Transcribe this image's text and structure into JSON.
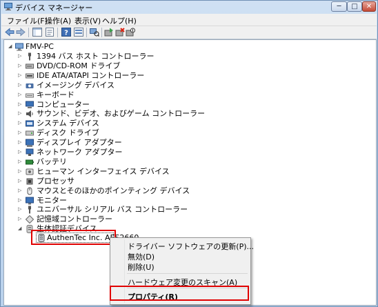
{
  "window": {
    "title": "デバイス マネージャー",
    "min_glyph": "─",
    "max_glyph": "□",
    "close_glyph": "✕"
  },
  "menu": [
    "ファイル(F)",
    "操作(A)",
    "表示(V)",
    "ヘルプ(H)"
  ],
  "toolbar": [
    "back-icon",
    "forward-icon",
    "show-hide-tree-icon",
    "properties-icon",
    "help-icon",
    "scan-hardware-icon",
    "update-driver-icon",
    "uninstall-icon",
    "disable-icon"
  ],
  "tree": {
    "root": "FMV-PC",
    "items": [
      {
        "label": "1394 バス ホスト コントローラー",
        "icon": "usb-plug-icon",
        "color": "#555555"
      },
      {
        "label": "DVD/CD-ROM ドライブ",
        "icon": "optical-drive-icon",
        "color": "#606060"
      },
      {
        "label": "IDE ATA/ATAPI コントローラー",
        "icon": "ide-controller-icon",
        "color": "#6c6c6c"
      },
      {
        "label": "イメージング デバイス",
        "icon": "camera-icon",
        "color": "#4a6fa5"
      },
      {
        "label": "キーボード",
        "icon": "keyboard-icon",
        "color": "#777777"
      },
      {
        "label": "コンピューター",
        "icon": "computer-icon",
        "color": "#3b72b8"
      },
      {
        "label": "サウンド、ビデオ、およびゲーム コントローラー",
        "icon": "speaker-icon",
        "color": "#555555"
      },
      {
        "label": "システム デバイス",
        "icon": "system-device-icon",
        "color": "#3b72b8"
      },
      {
        "label": "ディスク ドライブ",
        "icon": "disk-drive-icon",
        "color": "#707070"
      },
      {
        "label": "ディスプレイ アダプター",
        "icon": "display-adapter-icon",
        "color": "#3b72b8"
      },
      {
        "label": "ネットワーク アダプター",
        "icon": "network-adapter-icon",
        "color": "#3b72b8"
      },
      {
        "label": "バッテリ",
        "icon": "battery-icon",
        "color": "#2e8b3a"
      },
      {
        "label": "ヒューマン インターフェイス デバイス",
        "icon": "hid-icon",
        "color": "#666666"
      },
      {
        "label": "プロセッサ",
        "icon": "processor-icon",
        "color": "#555555"
      },
      {
        "label": "マウスとそのほかのポインティング デバイス",
        "icon": "mouse-icon",
        "color": "#555555"
      },
      {
        "label": "モニター",
        "icon": "monitor-icon",
        "color": "#3b72b8"
      },
      {
        "label": "ユニバーサル シリアル バス コントローラー",
        "icon": "usb-plug-icon",
        "color": "#555555"
      },
      {
        "label": "記憶域コントローラー",
        "icon": "storage-controller-icon",
        "color": "#666666"
      },
      {
        "label": "生体認証デバイス",
        "icon": "biometric-icon",
        "color": "#777777",
        "expanded": true
      }
    ],
    "child": {
      "label": "AuthenTec Inc. AES2660",
      "icon": "fingerprint-reader-icon"
    }
  },
  "context_menu": {
    "update_driver": "ドライバー ソフトウェアの更新(P)...",
    "disable": "無効(D)",
    "uninstall": "削除(U)",
    "scan": "ハードウェア変更のスキャン(A)",
    "properties": "プロパティ(R)"
  },
  "colors": {
    "highlight": "#e00000",
    "titlebar": "#c4d8ef"
  }
}
